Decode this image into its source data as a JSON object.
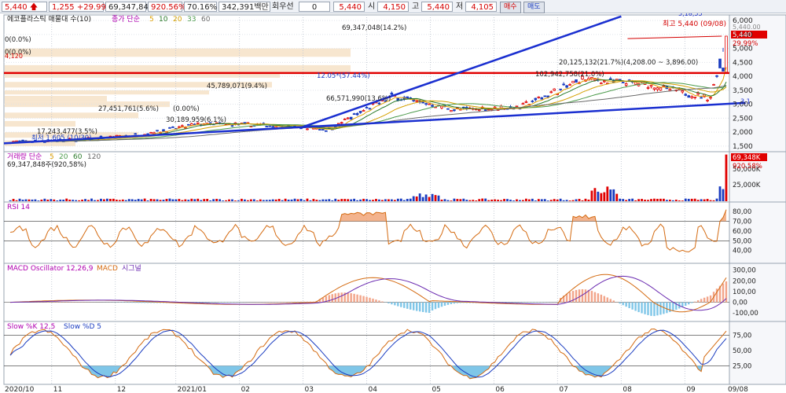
{
  "topbar": {
    "price": "5,440",
    "change": "1,255",
    "change_pct": "+29.99%",
    "volume": "69,347,848",
    "vol_ratio": "920.56%",
    "turnover": "70.16%",
    "amount": "342,391백만",
    "pref_label": "회우선",
    "pref_value": "0",
    "price2": "5,440",
    "open_label": "시",
    "open": "4,150",
    "high_label": "고",
    "high": "5,440",
    "low_label": "저",
    "low": "4,105",
    "buy_label": "매수",
    "sell_label": "매도"
  },
  "price_panel": {
    "title": "에코플라스틱 매물대 수(10)",
    "ma_label": "종가 단순",
    "ma_periods": [
      "5",
      "10",
      "20",
      "33",
      "60"
    ],
    "ma_colors": [
      "#e0a000",
      "#2a7a2a",
      "#d4a000",
      "#4b9a4b",
      "#6a6a6a"
    ],
    "y_ticks": [
      "6,000",
      "5,500",
      "5,000",
      "4,500",
      "4,000",
      "3,500",
      "3,000",
      "2,500",
      "2,000",
      "1,500"
    ],
    "last_price_label": "5,440",
    "last_pct_label": "29.99%",
    "high_annotation": "최고 5,440 (09/08)",
    "top_value_label": "5,440.00",
    "low_annotation": "최저 1,605 (10/30)",
    "red_line_label": "4,120",
    "trend_end_label": "3,1",
    "peak_label": "12.05*(57.44%)",
    "upper_trend_label": "5,18,55",
    "annotations": [
      "0(0.0%)",
      "0(0.0%)",
      "69,347,048(14.2%)",
      "45,789,071(9.4%)",
      "27,451,761(5.6%)",
      "(0.00%)",
      "66,571,990(13.6%)",
      "20,125,132(21.7%)(4,208.00 ~ 3,896.00)",
      "102,942,758(21.0%)",
      "17,243,477(3.5%)",
      "30,189,959(6.1%)"
    ]
  },
  "volume_panel": {
    "title": "거래량 단순",
    "ma_periods": [
      "5",
      "20",
      "60",
      "120"
    ],
    "subtitle": "69,347,848주(920,58%)",
    "y_ticks": [
      "50,000K",
      "25,000K"
    ],
    "last_label": "69,348K",
    "last_pct": "920.58%"
  },
  "rsi_panel": {
    "title": "RSI 14",
    "y_ticks": [
      "80,00",
      "70,00",
      "60,00",
      "50,00",
      "40,00"
    ]
  },
  "macd_panel": {
    "title": "MACD Oscillator 12,26,9",
    "line_label": "MACD",
    "signal_label": "시그널",
    "y_ticks": [
      "300,00",
      "200,00",
      "100,00",
      "0,00",
      "-100,00"
    ]
  },
  "stoch_panel": {
    "title": "Slow %K 12,5",
    "d_label": "Slow %D 5",
    "y_ticks": [
      "75,00",
      "50,00",
      "25,00"
    ]
  },
  "x_axis": [
    "2020/10",
    "11",
    "12",
    "2021/01",
    "02",
    "03",
    "04",
    "05",
    "06",
    "07",
    "08",
    "09",
    "09/08"
  ],
  "chart_data": {
    "type": "line",
    "title": "에코플라스틱",
    "months": [
      "2020/10",
      "11",
      "12",
      "2021/01",
      "02",
      "03",
      "04",
      "05",
      "06",
      "07",
      "08",
      "09",
      "09/08"
    ],
    "price_series": {
      "name": "종가",
      "months": [
        10,
        11,
        12,
        13,
        14,
        15,
        16,
        17,
        18,
        19,
        20,
        21,
        21.25
      ],
      "values": [
        1650,
        1720,
        1900,
        2300,
        2250,
        2100,
        3300,
        2800,
        2900,
        3900,
        3700,
        3200,
        5440
      ]
    },
    "ylim": [
      1300,
      6200
    ],
    "reference_lines": {
      "resistance": 4120
    },
    "extremes": {
      "high": 5440,
      "high_date": "09/08",
      "low": 1605,
      "low_date": "10/30"
    },
    "rsi": {
      "ylim": [
        30,
        85
      ],
      "last": 82
    },
    "macd": {
      "ylim": [
        -150,
        320
      ],
      "last": 230
    },
    "stochastic": {
      "ylim": [
        0,
        90
      ],
      "last": 80
    },
    "volume": {
      "last": 69348000,
      "unit": "K"
    }
  }
}
